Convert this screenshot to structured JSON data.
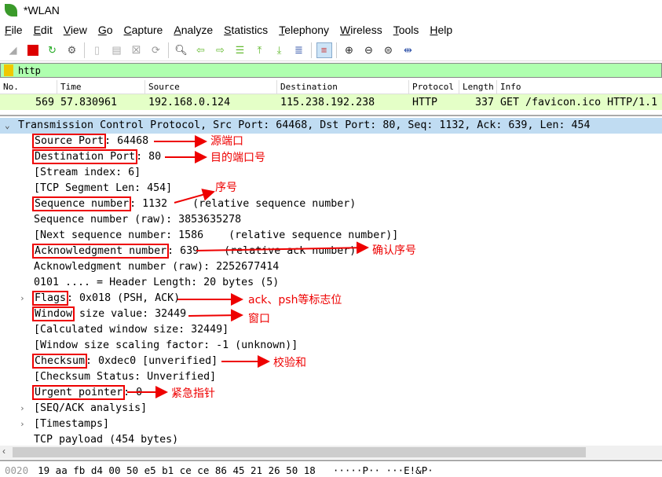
{
  "window": {
    "title": "*WLAN"
  },
  "menu": [
    "File",
    "Edit",
    "View",
    "Go",
    "Capture",
    "Analyze",
    "Statistics",
    "Telephony",
    "Wireless",
    "Tools",
    "Help"
  ],
  "filter": {
    "value": "http"
  },
  "packet_list": {
    "columns": [
      "No.",
      "Time",
      "Source",
      "Destination",
      "Protocol",
      "Length",
      "Info"
    ],
    "row": {
      "no": "569",
      "time": "57.830961",
      "source": "192.168.0.124",
      "destination": "115.238.192.238",
      "protocol": "HTTP",
      "length": "337",
      "info": "GET /favicon.ico HTTP/1.1"
    }
  },
  "tree": {
    "header": "Transmission Control Protocol, Src Port: 64468, Dst Port: 80, Seq: 1132, Ack: 639, Len: 454",
    "rows": [
      {
        "name": "Source Port",
        "rest": ": 64468"
      },
      {
        "name": "Destination Port",
        "rest": ": 80"
      },
      {
        "name": "",
        "rest": "[Stream index: 6]"
      },
      {
        "name": "",
        "rest": "[TCP Segment Len: 454]"
      },
      {
        "name": "Sequence number",
        "rest": ": 1132    (relative sequence number)"
      },
      {
        "name": "",
        "rest": "Sequence number (raw): 3853635278"
      },
      {
        "name": "",
        "rest": "[Next sequence number: 1586    (relative sequence number)]"
      },
      {
        "name": "Acknowledgment number",
        "rest": ": 639    (relative ack number)"
      },
      {
        "name": "",
        "rest": "Acknowledgment number (raw): 2252677414"
      },
      {
        "name": "",
        "rest": "0101 .... = Header Length: 20 bytes (5)"
      },
      {
        "name": "Flags",
        "rest": ": 0x018 (PSH, ACK)",
        "expand": true
      },
      {
        "name": "Window",
        "rest": " size value: 32449"
      },
      {
        "name": "",
        "rest": "[Calculated window size: 32449]"
      },
      {
        "name": "",
        "rest": "[Window size scaling factor: -1 (unknown)]"
      },
      {
        "name": "Checksum",
        "rest": ": 0xdec0 [unverified]"
      },
      {
        "name": "",
        "rest": "[Checksum Status: Unverified]"
      },
      {
        "name": "Urgent pointer",
        "rest": ": 0"
      },
      {
        "name": "",
        "rest": "[SEQ/ACK analysis]",
        "expand": true
      },
      {
        "name": "",
        "rest": "[Timestamps]",
        "expand": true
      },
      {
        "name": "",
        "rest": "TCP payload (454 bytes)"
      }
    ]
  },
  "annotations": [
    "源端口",
    "目的端口号",
    "序号",
    "确认序号",
    "ack、psh等标志位",
    "窗口",
    "校验和",
    "紧急指针"
  ],
  "bytes": {
    "offset": "0020",
    "hex": "19 aa fb d4 00 50 e5 b1  ce ce 86 45 21 26 50 18",
    "ascii": "·····P·· ···E!&P·"
  },
  "colors": {
    "filter_bg": "#afffaf",
    "selected_packet": "#e4ffc7",
    "selected_tree": "#c0dcf2",
    "annotation": "#ee0000"
  }
}
